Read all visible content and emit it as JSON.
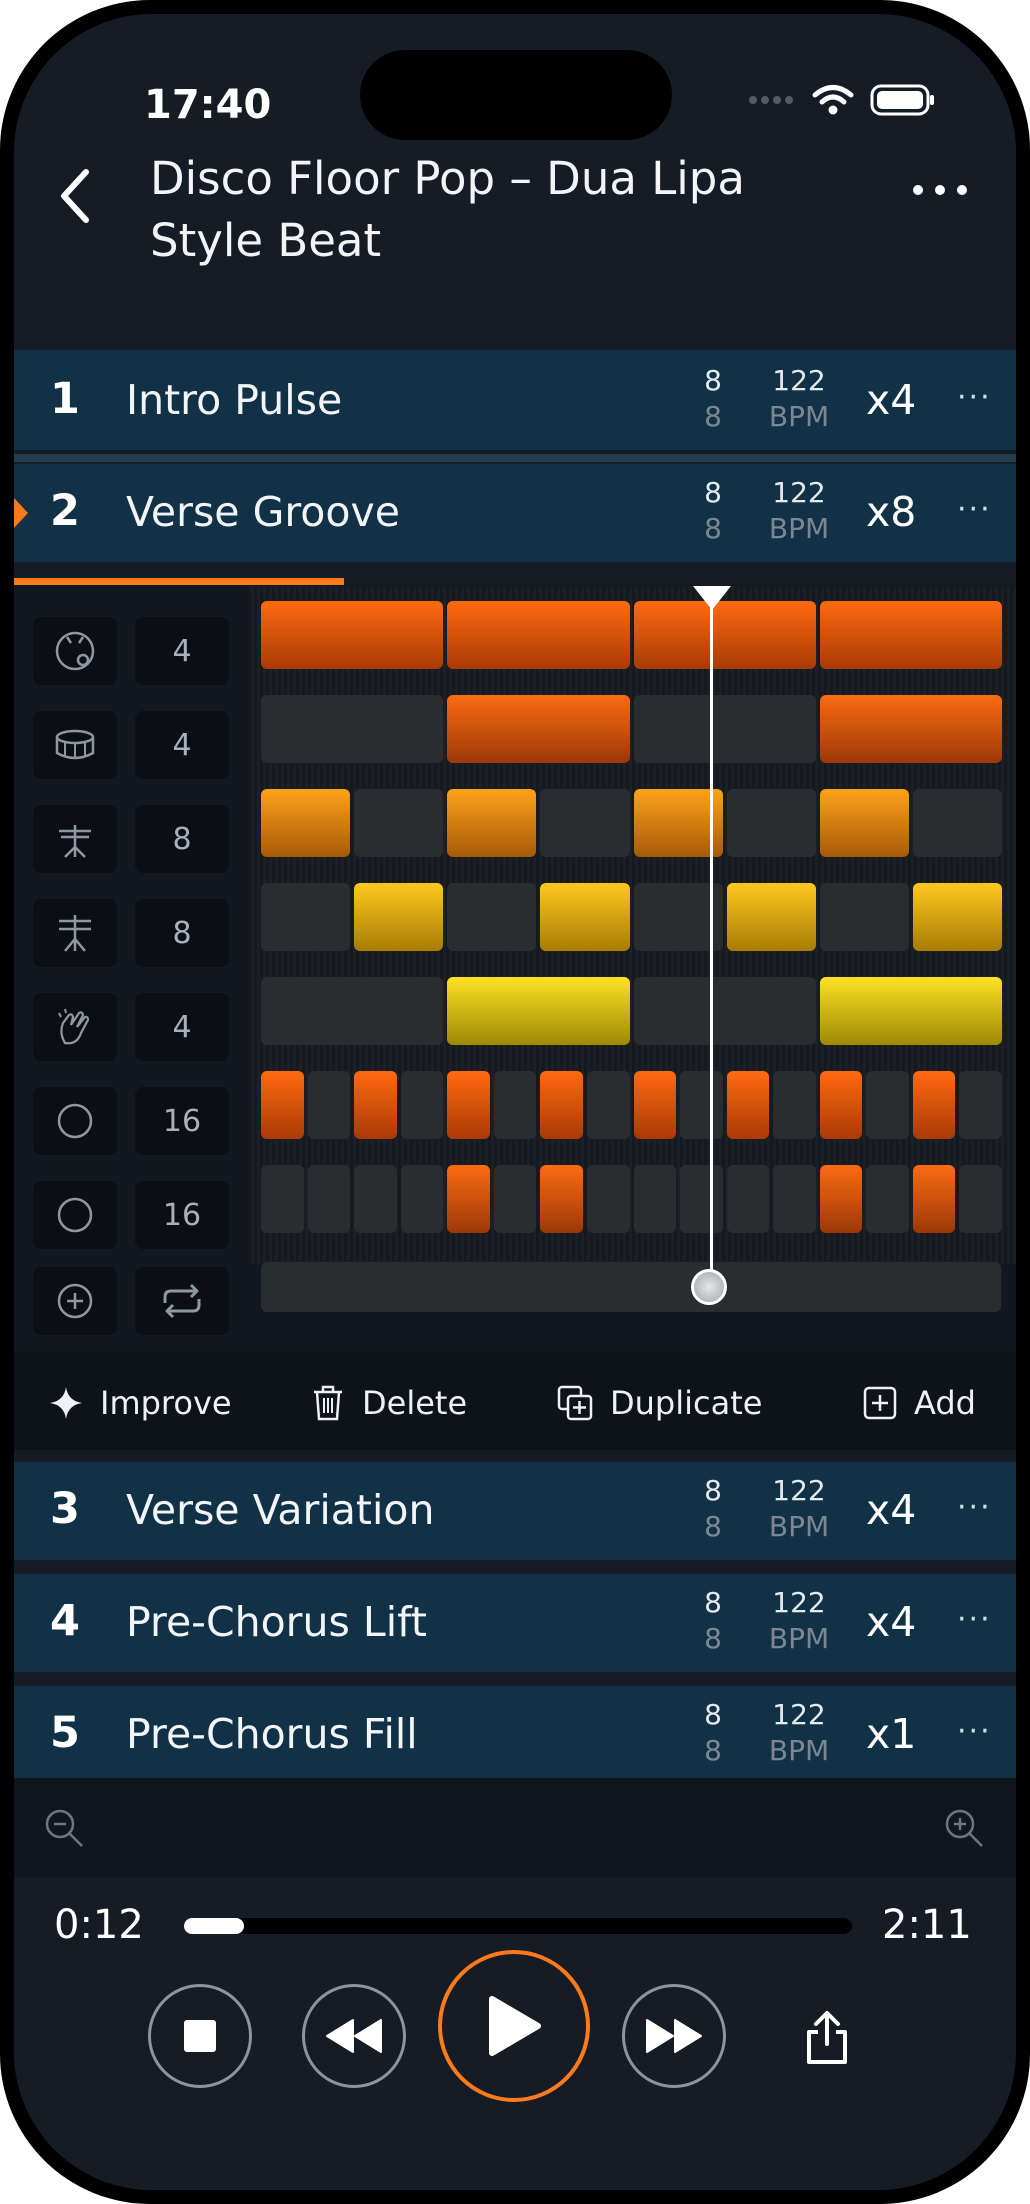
{
  "status": {
    "time": "17:40"
  },
  "header": {
    "title_line1": "Disco Floor Pop – Dua Lipa",
    "title_line2": "Style Beat"
  },
  "sections": [
    {
      "num": "1",
      "name": "Intro Pulse",
      "sig_top": "8",
      "sig_bottom": "8",
      "bpm": "122",
      "bpm_label": "BPM",
      "repeat": "x4",
      "more": "···"
    },
    {
      "num": "2",
      "name": "Verse Groove",
      "sig_top": "8",
      "sig_bottom": "8",
      "bpm": "122",
      "bpm_label": "BPM",
      "repeat": "x8",
      "more": "···",
      "playing": true,
      "progress": 0.33
    },
    {
      "num": "3",
      "name": "Verse Variation",
      "sig_top": "8",
      "sig_bottom": "8",
      "bpm": "122",
      "bpm_label": "BPM",
      "repeat": "x4",
      "more": "···"
    },
    {
      "num": "4",
      "name": "Pre-Chorus Lift",
      "sig_top": "8",
      "sig_bottom": "8",
      "bpm": "122",
      "bpm_label": "BPM",
      "repeat": "x4",
      "more": "···"
    },
    {
      "num": "5",
      "name": "Pre-Chorus Fill",
      "sig_top": "8",
      "sig_bottom": "8",
      "bpm": "122",
      "bpm_label": "BPM",
      "repeat": "x1",
      "more": "···"
    }
  ],
  "tracks": [
    {
      "icon": "kick-drum-icon",
      "steps": "4"
    },
    {
      "icon": "snare-drum-icon",
      "steps": "4"
    },
    {
      "icon": "hihat-icon",
      "steps": "8"
    },
    {
      "icon": "open-hihat-icon",
      "steps": "8"
    },
    {
      "icon": "clap-icon",
      "steps": "4"
    },
    {
      "icon": "circle-icon",
      "steps": "16"
    },
    {
      "icon": "circle-icon",
      "steps": "16"
    }
  ],
  "toolbar": {
    "improve": "Improve",
    "delete": "Delete",
    "duplicate": "Duplicate",
    "add": "Add"
  },
  "playback": {
    "elapsed": "0:12",
    "total": "2:11",
    "position": 0.09
  },
  "colors": {
    "accent": "#ff7a1a",
    "section_bg": "#113246",
    "background": "#151c25"
  }
}
